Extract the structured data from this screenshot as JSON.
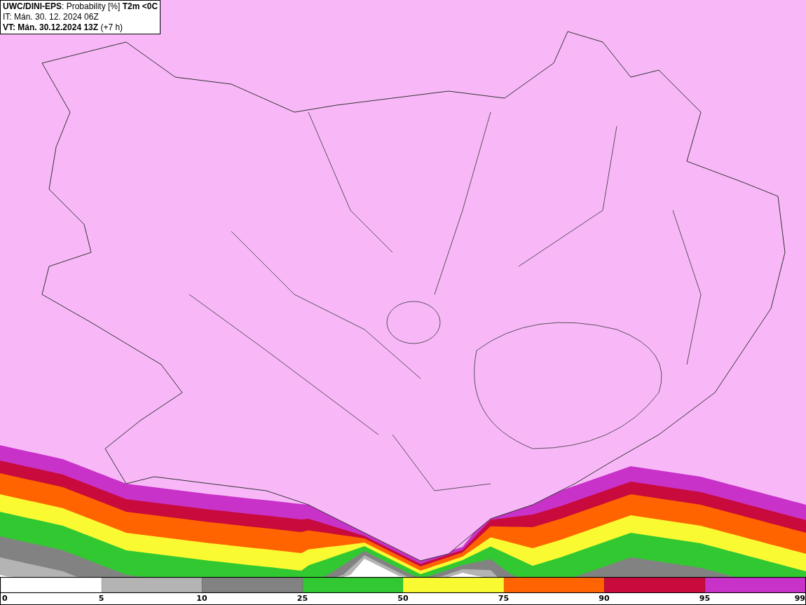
{
  "header": {
    "title": "**UWC/DINI-EPS**: Probability [%] **T2m <0C**",
    "init_time": "IT: Mán. 30. 12. 2024 06Z",
    "valid_time": "**VT: Mán. 30.12.2024 13Z** (+7 h)"
  },
  "legend": {
    "segments": [
      {
        "color": "#ffffff"
      },
      {
        "color": "#b4b4b4"
      },
      {
        "color": "#828282"
      },
      {
        "color": "#32c832"
      },
      {
        "color": "#fafa32"
      },
      {
        "color": "#ff6400"
      },
      {
        "color": "#c80a3c"
      },
      {
        "color": "#c832c8"
      }
    ],
    "labels": [
      "0",
      "5",
      "10",
      "25",
      "50",
      "75",
      "90",
      "95",
      "99"
    ]
  }
}
